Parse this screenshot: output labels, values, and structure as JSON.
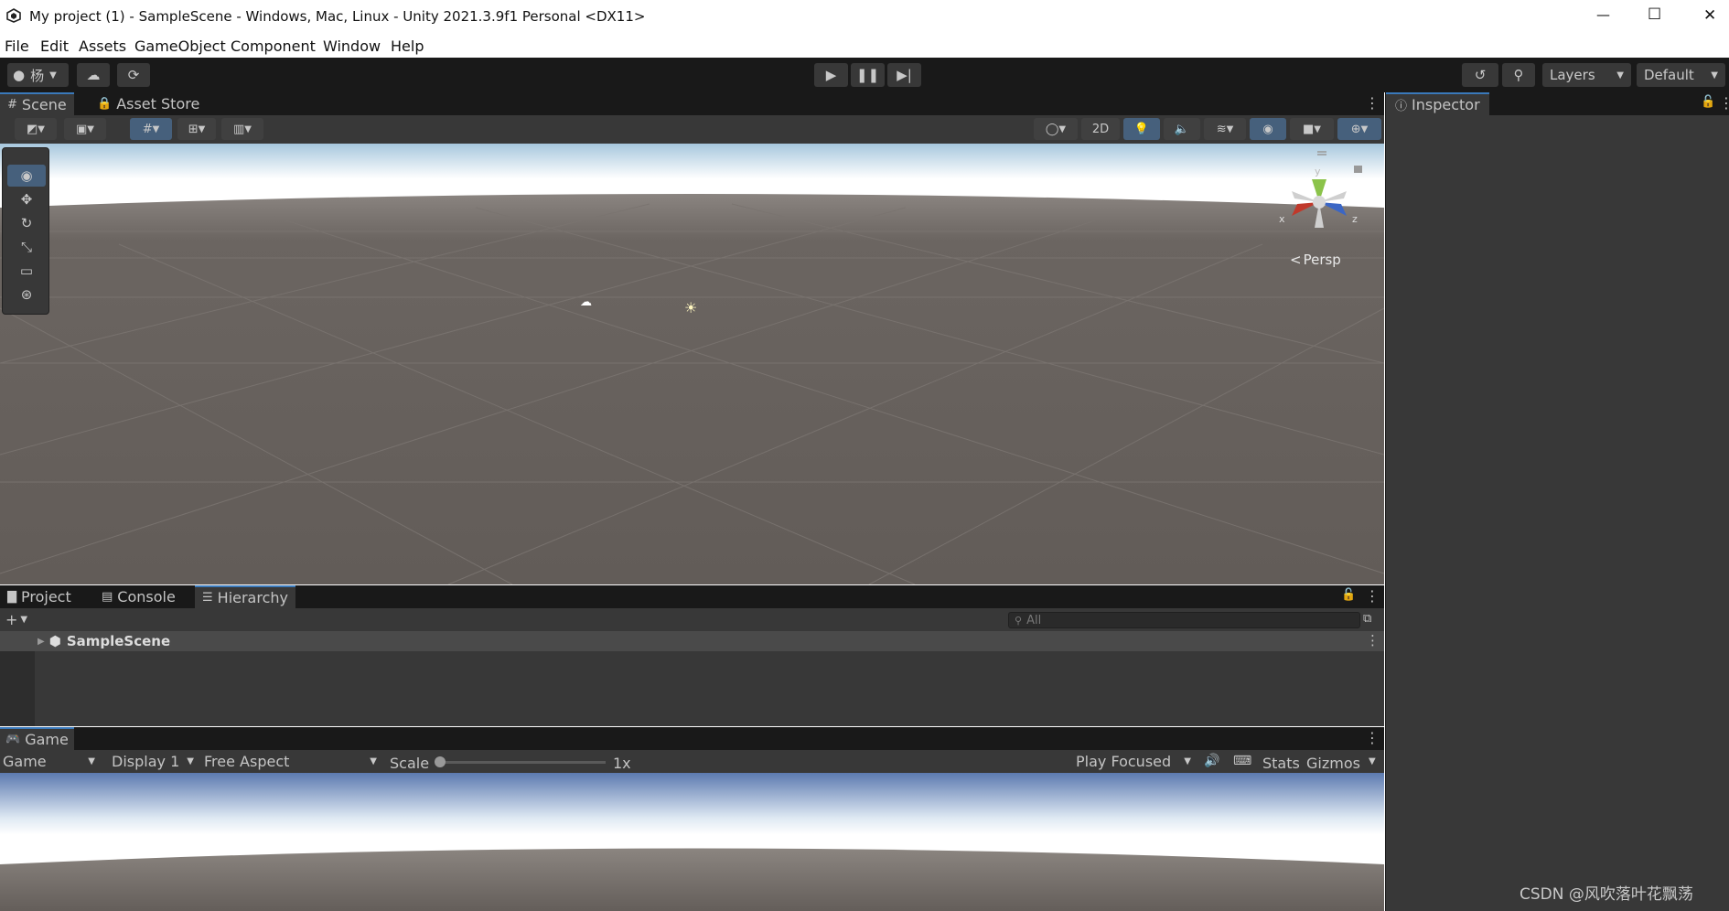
{
  "window": {
    "title": "My project (1) - SampleScene - Windows, Mac, Linux - Unity 2021.3.9f1 Personal <DX11>",
    "minimize": "—",
    "maximize": "☐",
    "close": "✕"
  },
  "menu": [
    "File",
    "Edit",
    "Assets",
    "GameObject",
    "Component",
    "Window",
    "Help"
  ],
  "toolbar": {
    "account_label": "杨",
    "layers_label": "Layers",
    "layout_label": "Default"
  },
  "scene_panel": {
    "tabs": [
      "Scene",
      "Asset Store"
    ],
    "mode_2d": "2D",
    "gizmo": {
      "y": "y",
      "x": "x",
      "z": "z",
      "projection": "Persp"
    }
  },
  "bottom_panel": {
    "tabs": [
      "Project",
      "Console",
      "Hierarchy"
    ],
    "search_placeholder": "All",
    "scene_name": "SampleScene"
  },
  "game_panel": {
    "tab": "Game",
    "view_select": "Game",
    "display_select": "Display 1",
    "aspect_select": "Free Aspect",
    "scale_label": "Scale",
    "scale_value": "1x",
    "play_mode": "Play Focused",
    "stats": "Stats",
    "gizmos": "Gizmos"
  },
  "inspector": {
    "tab": "Inspector"
  },
  "watermark": "CSDN @风吹落叶花飘荡",
  "colors": {
    "editor_bg": "#383838",
    "accent": "#3a79bb",
    "ground": "#645e5a"
  }
}
